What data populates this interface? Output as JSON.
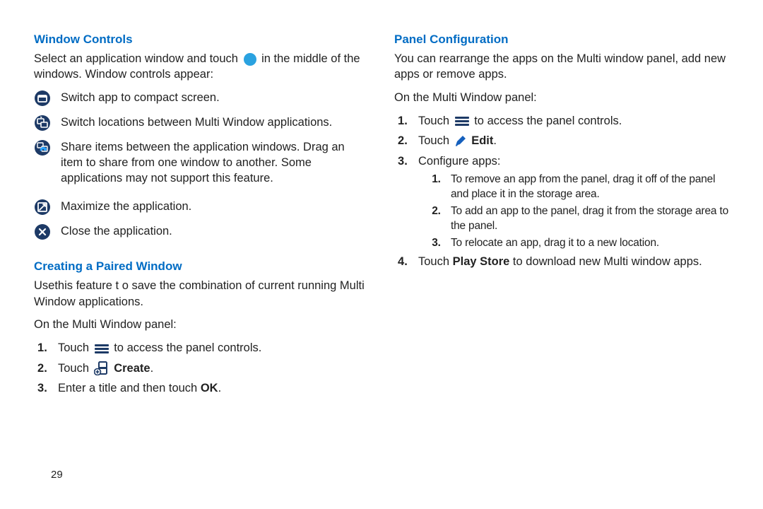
{
  "page_number": "29",
  "left": {
    "heading1": "Window Controls",
    "intro_a": "Select an application window and touch ",
    "intro_b": " in the middle of the windows. Window controls appear:",
    "items": [
      "Switch app to compact screen.",
      "Switch locations between Multi Window applications.",
      "Share items between the application windows. Drag an item to share from one window to another. Some applications may not support this feature.",
      "Maximize the application.",
      "Close the application."
    ],
    "heading2": "Creating a Paired Window",
    "p2": "Usethis feature t o save the combination of current running Multi Window applications.",
    "p3": "On the Multi Window panel:",
    "steps": {
      "s1a": "Touch ",
      "s1b": " to access the panel controls.",
      "s2a": "Touch ",
      "s2b": "Create",
      "s2c": ".",
      "s3a": "Enter a title and then touch ",
      "s3b": "OK",
      "s3c": "."
    }
  },
  "right": {
    "heading": "Panel Configuration",
    "p1": "You can rearrange the apps on the Multi window panel, add new apps or remove apps.",
    "p2": "On the Multi Window panel:",
    "steps": {
      "s1a": "Touch ",
      "s1b": " to access the panel controls.",
      "s2a": "Touch ",
      "s2b": "Edit",
      "s2c": ".",
      "s3": "Configure apps:",
      "bullets": [
        "To remove an app from the panel, drag it off of the panel and place it in the storage area.",
        "To add an app to the panel, drag it from the storage area to the panel.",
        "To relocate an app, drag it to a new location."
      ],
      "s4a": "Touch ",
      "s4b": "Play Store",
      "s4c": " to download new Multi window apps."
    }
  }
}
